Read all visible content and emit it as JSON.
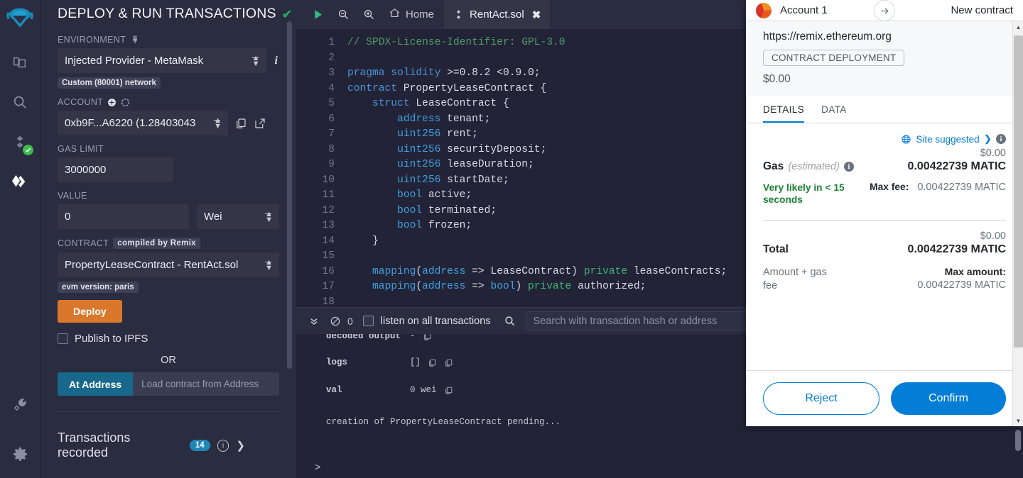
{
  "rail": {
    "items": [
      {
        "name": "remix-logo",
        "label": "Remix"
      },
      {
        "name": "file-explorer-icon",
        "label": "File explorer"
      },
      {
        "name": "search-icon",
        "label": "Search in files"
      },
      {
        "name": "solidity-compiler-icon",
        "label": "Solidity compiler"
      },
      {
        "name": "deploy-run-icon",
        "label": "Deploy & run transactions"
      }
    ],
    "bottom": [
      {
        "name": "plugin-manager-icon",
        "label": "Plugin manager"
      },
      {
        "name": "settings-gear-icon",
        "label": "Settings"
      }
    ]
  },
  "panel": {
    "title": "DEPLOY & RUN TRANSACTIONS",
    "environment": {
      "label": "ENVIRONMENT",
      "value": "Injected Provider - MetaMask",
      "network_badge": "Custom (80001) network"
    },
    "account": {
      "label": "ACCOUNT",
      "value": "0xb9F...A6220 (1.28403043"
    },
    "gas_limit": {
      "label": "GAS LIMIT",
      "value": "3000000"
    },
    "value_field": {
      "label": "VALUE",
      "value": "0",
      "unit": "Wei"
    },
    "contract": {
      "label": "CONTRACT",
      "compiled_badge": "compiled by Remix",
      "value": "PropertyLeaseContract - RentAct.sol",
      "evm_badge": "evm version: paris"
    },
    "deploy_label": "Deploy",
    "publish_ipfs_label": "Publish to IPFS",
    "or_label": "OR",
    "at_address_label": "At Address",
    "at_address_placeholder": "Load contract from Address",
    "transactions_recorded_label": "Transactions recorded",
    "transactions_recorded_count": "14"
  },
  "editor": {
    "toolbar": {
      "run_label": "run",
      "zoom_out_label": "zoom out",
      "zoom_in_label": "zoom in",
      "home_label": "Home",
      "tab_label": "RentAct.sol"
    },
    "lines": [
      {
        "n": "1",
        "segments": [
          {
            "t": "// SPDX-License-Identifier: GPL-3.0",
            "c": "tok-com"
          }
        ]
      },
      {
        "n": "2",
        "segments": [
          {
            "t": "",
            "c": "ctext"
          }
        ]
      },
      {
        "n": "3",
        "segments": [
          {
            "t": "pragma ",
            "c": "tok-kw"
          },
          {
            "t": "solidity ",
            "c": "tok-kw"
          },
          {
            "t": ">=0.8.2 <0.9.0;",
            "c": "ctext"
          }
        ]
      },
      {
        "n": "4",
        "segments": [
          {
            "t": "contract ",
            "c": "tok-kw"
          },
          {
            "t": "PropertyLeaseContract {",
            "c": "ctext"
          }
        ]
      },
      {
        "n": "5",
        "segments": [
          {
            "t": "    struct ",
            "c": "tok-kw"
          },
          {
            "t": "LeaseContract {",
            "c": "ctext"
          }
        ]
      },
      {
        "n": "6",
        "segments": [
          {
            "t": "        ",
            "c": "ctext"
          },
          {
            "t": "address ",
            "c": "tok-kw2"
          },
          {
            "t": "tenant;",
            "c": "ctext"
          }
        ]
      },
      {
        "n": "7",
        "segments": [
          {
            "t": "        ",
            "c": "ctext"
          },
          {
            "t": "uint256 ",
            "c": "tok-kw2"
          },
          {
            "t": "rent;",
            "c": "ctext"
          }
        ]
      },
      {
        "n": "8",
        "segments": [
          {
            "t": "        ",
            "c": "ctext"
          },
          {
            "t": "uint256 ",
            "c": "tok-kw2"
          },
          {
            "t": "securityDeposit;",
            "c": "ctext"
          }
        ]
      },
      {
        "n": "9",
        "segments": [
          {
            "t": "        ",
            "c": "ctext"
          },
          {
            "t": "uint256 ",
            "c": "tok-kw2"
          },
          {
            "t": "leaseDuration;",
            "c": "ctext"
          }
        ]
      },
      {
        "n": "10",
        "segments": [
          {
            "t": "        ",
            "c": "ctext"
          },
          {
            "t": "uint256 ",
            "c": "tok-kw2"
          },
          {
            "t": "startDate;",
            "c": "ctext"
          }
        ]
      },
      {
        "n": "11",
        "segments": [
          {
            "t": "        ",
            "c": "ctext"
          },
          {
            "t": "bool ",
            "c": "tok-kw2"
          },
          {
            "t": "active;",
            "c": "ctext"
          }
        ]
      },
      {
        "n": "12",
        "segments": [
          {
            "t": "        ",
            "c": "ctext"
          },
          {
            "t": "bool ",
            "c": "tok-kw2"
          },
          {
            "t": "terminated;",
            "c": "ctext"
          }
        ]
      },
      {
        "n": "13",
        "segments": [
          {
            "t": "        ",
            "c": "ctext"
          },
          {
            "t": "bool ",
            "c": "tok-kw2"
          },
          {
            "t": "frozen;",
            "c": "ctext"
          }
        ]
      },
      {
        "n": "14",
        "segments": [
          {
            "t": "    }",
            "c": "ctext"
          }
        ]
      },
      {
        "n": "15",
        "segments": [
          {
            "t": "",
            "c": "ctext"
          }
        ]
      },
      {
        "n": "16",
        "segments": [
          {
            "t": "    ",
            "c": "ctext"
          },
          {
            "t": "mapping",
            "c": "tok-kw2"
          },
          {
            "t": "(",
            "c": "ctext"
          },
          {
            "t": "address ",
            "c": "tok-kw2"
          },
          {
            "t": "=> LeaseContract) ",
            "c": "ctext"
          },
          {
            "t": "private ",
            "c": "tok-grn"
          },
          {
            "t": "leaseContracts;",
            "c": "ctext"
          }
        ]
      },
      {
        "n": "17",
        "segments": [
          {
            "t": "    ",
            "c": "ctext"
          },
          {
            "t": "mapping",
            "c": "tok-kw2"
          },
          {
            "t": "(",
            "c": "ctext"
          },
          {
            "t": "address ",
            "c": "tok-kw2"
          },
          {
            "t": "=> ",
            "c": "ctext"
          },
          {
            "t": "bool",
            "c": "tok-kw2"
          },
          {
            "t": ") ",
            "c": "ctext"
          },
          {
            "t": "private ",
            "c": "tok-grn"
          },
          {
            "t": "authorized;",
            "c": "ctext"
          }
        ]
      },
      {
        "n": "18",
        "segments": [
          {
            "t": "",
            "c": "ctext"
          }
        ]
      }
    ]
  },
  "terminal": {
    "count": "0",
    "listen_label": "listen on all transactions",
    "search_placeholder": "Search with transaction hash or address",
    "rows": [
      {
        "key": "decoded output",
        "value": "-"
      },
      {
        "key": "logs",
        "value": "[]"
      },
      {
        "key": "val",
        "value": "0 wei"
      }
    ],
    "message": "creation of PropertyLeaseContract pending...",
    "prompt": ">"
  },
  "metamask": {
    "account_name": "Account 1",
    "destination": "New contract",
    "origin_url": "https://remix.ethereum.org",
    "origin_tag": "CONTRACT DEPLOYMENT",
    "origin_amount": "$0.00",
    "tabs": [
      {
        "label": "DETAILS",
        "active": true
      },
      {
        "label": "DATA",
        "active": false
      }
    ],
    "site_suggested": "Site suggested",
    "gas": {
      "fiat": "$0.00",
      "label": "Gas",
      "estimated": "(estimated)",
      "crypto": "0.00422739 MATIC",
      "speed": "Very likely in < 15 seconds",
      "max_fee_label": "Max fee:",
      "max_fee_value": "0.00422739 MATIC"
    },
    "total": {
      "fiat": "$0.00",
      "label": "Total",
      "crypto": "0.00422739 MATIC",
      "sub_label": "Amount + gas fee",
      "max_amount_label": "Max amount:",
      "max_amount_value": "0.00422739 MATIC"
    },
    "reject_label": "Reject",
    "confirm_label": "Confirm"
  },
  "colors": {
    "panel_bg": "#2a2c3f",
    "editor_bg": "#222336",
    "deploy_orange": "#d9782d",
    "at_address_blue": "#17688c",
    "mm_blue": "#037dd6",
    "success_green": "#1c8234",
    "badge_blue": "#1e87b5"
  }
}
